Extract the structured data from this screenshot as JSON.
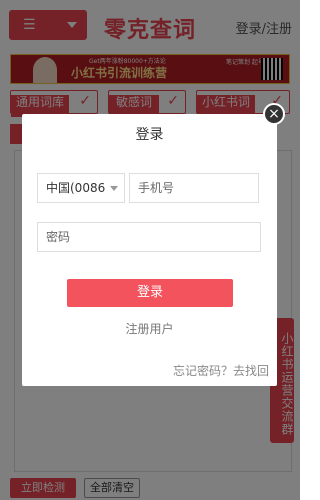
{
  "header": {
    "menu_icon": "☰",
    "logo_text": "零克查词",
    "login_link": "登录/注册"
  },
  "banner": {
    "subtitle": "Get两年涨粉80000+方法论",
    "title": "小红书引流训练营",
    "side_text": "笔记策划 起号运营"
  },
  "tabs": [
    {
      "label": "通用词库",
      "check": "✓"
    },
    {
      "label": "敏感词",
      "check": "✓"
    },
    {
      "label": "小红书词",
      "check": "✓"
    }
  ],
  "bottom": {
    "check_button": "立即检测",
    "clear_button": "全部清空"
  },
  "side_tab": {
    "label": "小红书运营交流群"
  },
  "modal": {
    "title": "登录",
    "close_icon": "×",
    "country_value": "中国(0086",
    "phone_placeholder": "手机号",
    "password_placeholder": "密码",
    "login_button": "登录",
    "register_link": "注册用户",
    "forgot_link": "忘记密码？去找回"
  },
  "colors": {
    "accent": "#e8434f"
  }
}
